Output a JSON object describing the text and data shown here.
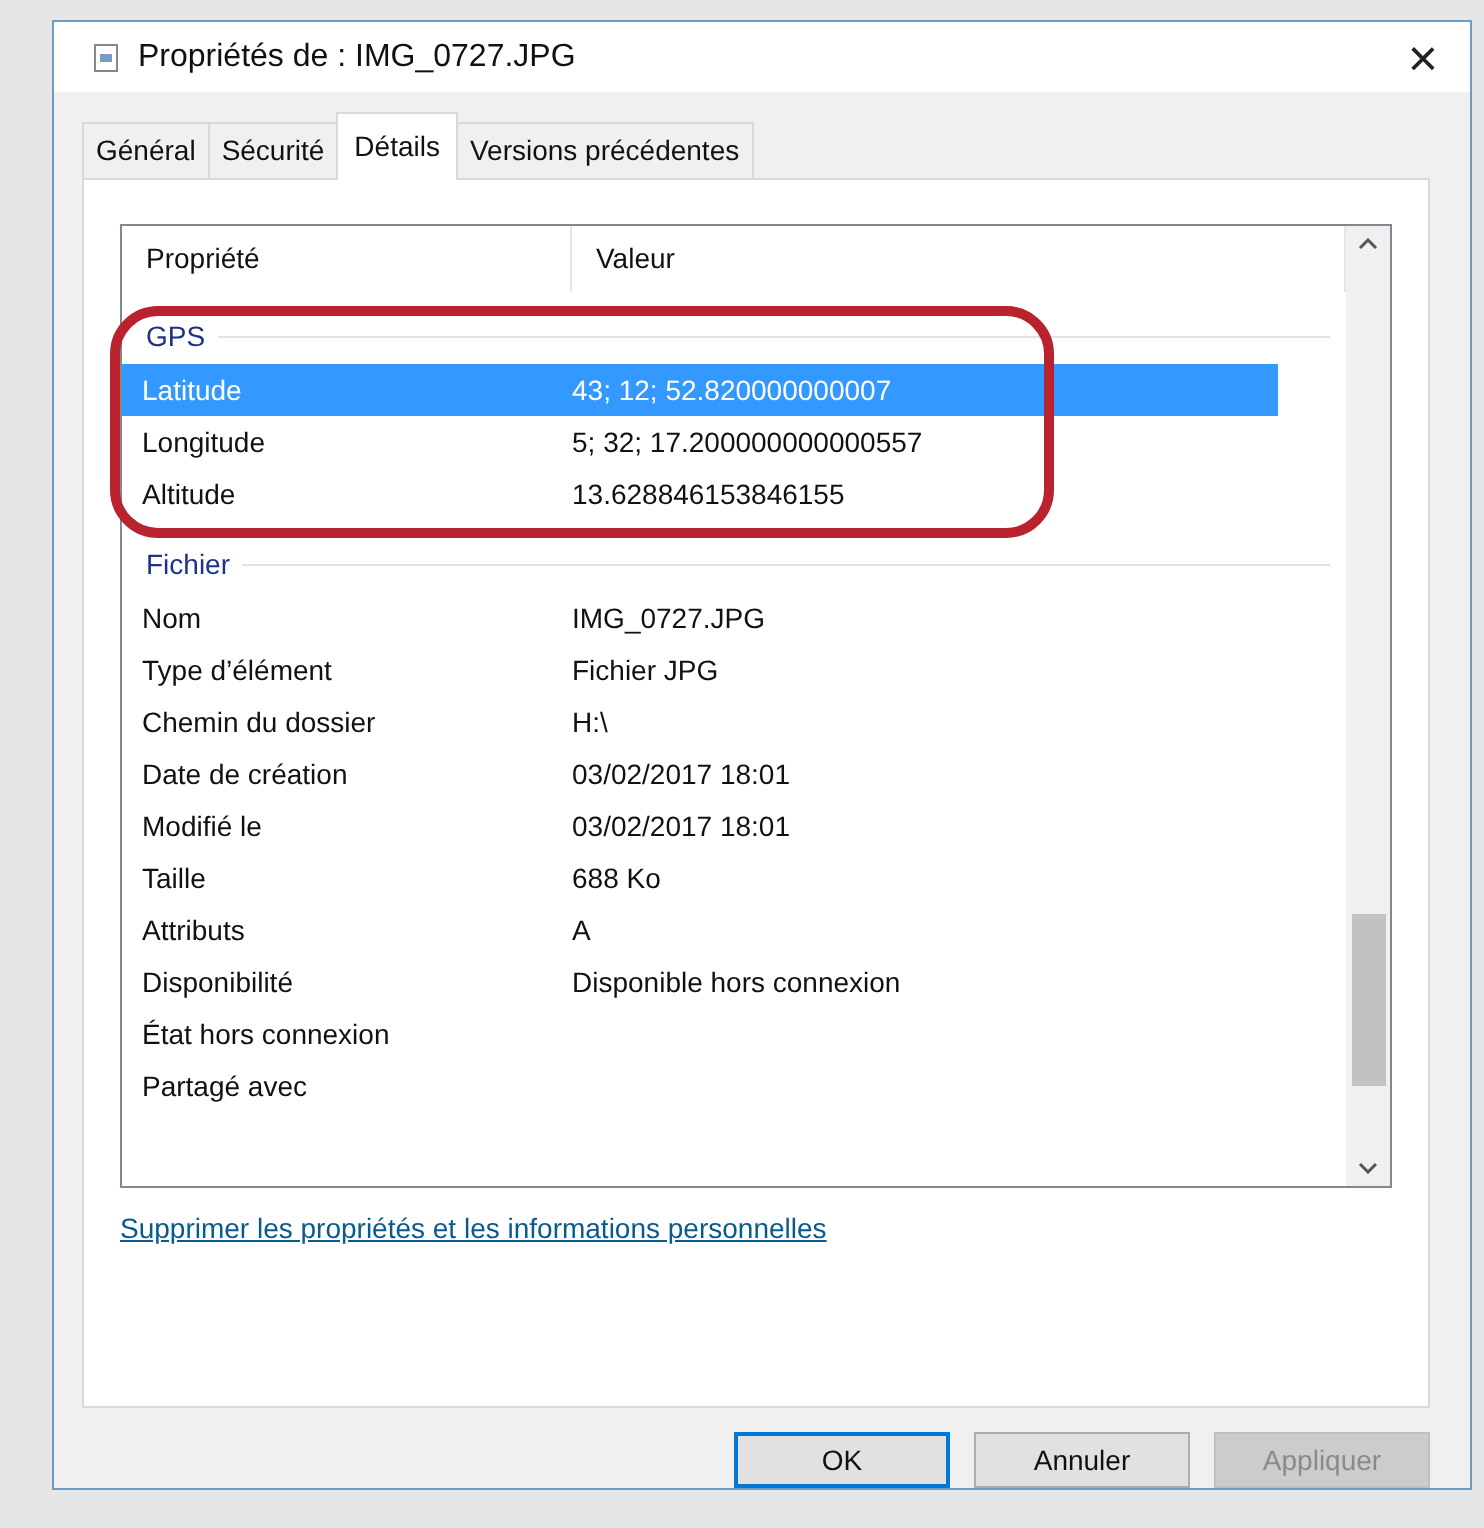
{
  "window": {
    "title": "Propriétés de : IMG_0727.JPG",
    "close": "×"
  },
  "tabs": [
    {
      "label": "Général",
      "selected": false
    },
    {
      "label": "Sécurité",
      "selected": false
    },
    {
      "label": "Détails",
      "selected": true
    },
    {
      "label": "Versions précédentes",
      "selected": false
    }
  ],
  "list": {
    "columns": [
      "Propriété",
      "Valeur"
    ],
    "rows": [
      {
        "kind": "group",
        "label": "GPS"
      },
      {
        "kind": "row",
        "label": "Latitude",
        "value": "43; 12; 52.820000000007",
        "selected": true
      },
      {
        "kind": "row",
        "label": "Longitude",
        "value": "5; 32; 17.200000000000557",
        "selected": false
      },
      {
        "kind": "row",
        "label": "Altitude",
        "value": "13.628846153846155",
        "selected": false
      },
      {
        "kind": "group",
        "label": "Fichier"
      },
      {
        "kind": "row",
        "label": "Nom",
        "value": "IMG_0727.JPG",
        "selected": false
      },
      {
        "kind": "row",
        "label": "Type d’élément",
        "value": "Fichier JPG",
        "selected": false
      },
      {
        "kind": "row",
        "label": "Chemin du dossier",
        "value": "H:\\",
        "selected": false
      },
      {
        "kind": "row",
        "label": "Date de création",
        "value": "03/02/2017 18:01",
        "selected": false
      },
      {
        "kind": "row",
        "label": "Modifié le",
        "value": "03/02/2017 18:01",
        "selected": false
      },
      {
        "kind": "row",
        "label": "Taille",
        "value": "688 Ko",
        "selected": false
      },
      {
        "kind": "row",
        "label": "Attributs",
        "value": "A",
        "selected": false
      },
      {
        "kind": "row",
        "label": "Disponibilité",
        "value": "Disponible hors connexion",
        "selected": false
      },
      {
        "kind": "row",
        "label": "État hors connexion",
        "selected": false
      },
      {
        "kind": "row",
        "label": "Partagé avec",
        "selected": false
      }
    ]
  },
  "link": "Supprimer les propriétés et les informations personnelles",
  "buttons": [
    {
      "label": "OK",
      "kind": "default",
      "disabled": false
    },
    {
      "label": "Annuler",
      "kind": "normal",
      "disabled": false
    },
    {
      "label": "Appliquer",
      "kind": "normal",
      "disabled": true
    }
  ]
}
